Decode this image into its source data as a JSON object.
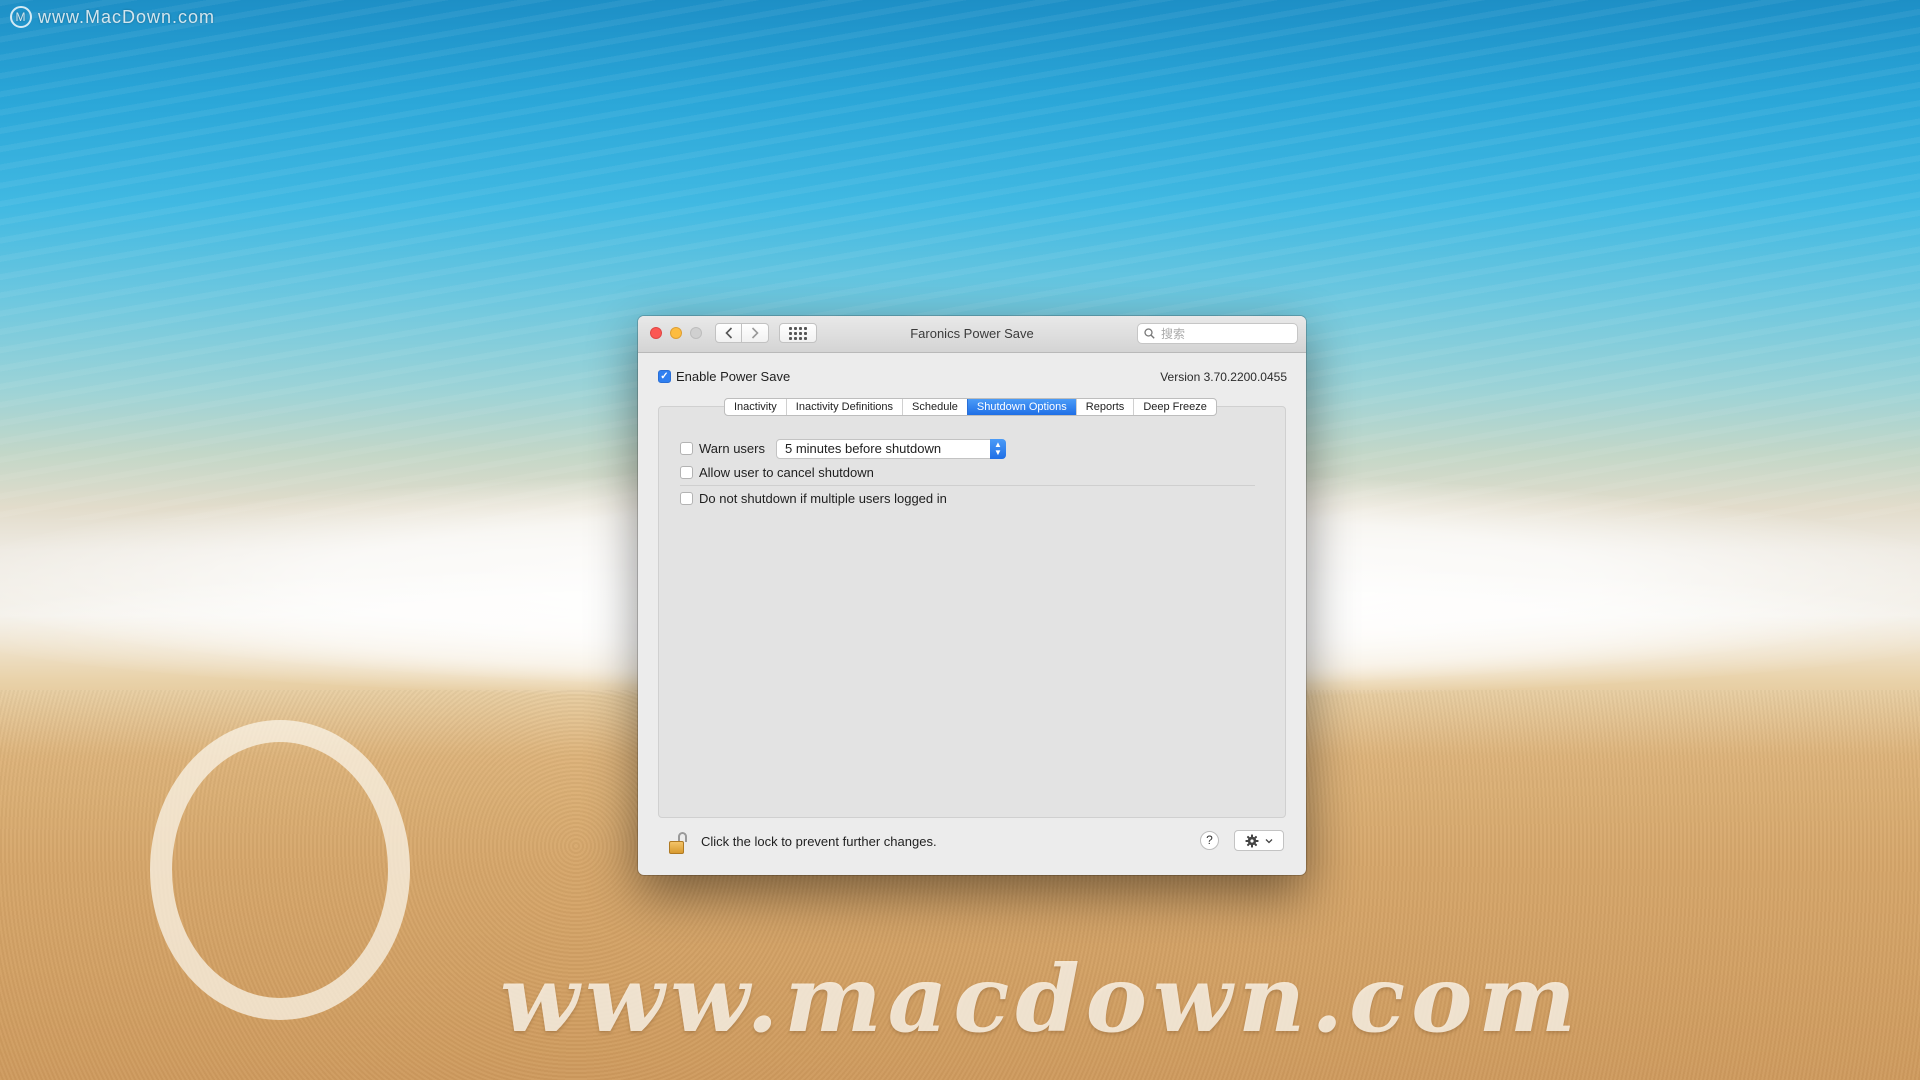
{
  "desktop": {
    "watermark_top": "www.MacDown.com",
    "watermark_logo": "M",
    "sand_text": "www.macdown.com"
  },
  "window": {
    "title": "Faronics Power Save",
    "search_placeholder": "搜索",
    "nav": {
      "back_icon": "chevron-left-icon",
      "forward_icon": "chevron-right-icon",
      "grid_icon": "grid-icon"
    }
  },
  "header": {
    "enable_label": "Enable Power Save",
    "enable_checked": true,
    "version": "Version 3.70.2200.0455"
  },
  "tabs": [
    {
      "label": "Inactivity",
      "active": false
    },
    {
      "label": "Inactivity Definitions",
      "active": false
    },
    {
      "label": "Schedule",
      "active": false
    },
    {
      "label": "Shutdown Options",
      "active": true
    },
    {
      "label": "Reports",
      "active": false
    },
    {
      "label": "Deep Freeze",
      "active": false
    }
  ],
  "shutdown_options": {
    "warn_users": {
      "label": "Warn users",
      "checked": false,
      "selected": "5 minutes before shutdown"
    },
    "allow_cancel": {
      "label": "Allow user to cancel shutdown",
      "checked": false
    },
    "multi_users": {
      "label": "Do not shutdown if multiple users logged in",
      "checked": false
    }
  },
  "footer": {
    "lock_text": "Click the lock to prevent further changes.",
    "help_label": "?",
    "gear_icon": "gear-icon"
  },
  "colors": {
    "accent": "#1f6fe6",
    "close": "#fc5753",
    "minimize": "#fdbc40",
    "zoom_disabled": "#d0d0d0"
  }
}
